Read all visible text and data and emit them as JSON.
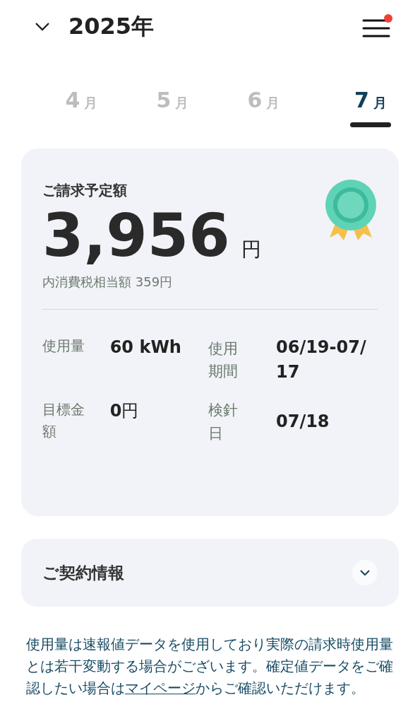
{
  "header": {
    "year": "2025年",
    "menu_badge": true
  },
  "month_tabs": [
    {
      "number": "4",
      "unit": "月",
      "selected": false
    },
    {
      "number": "5",
      "unit": "月",
      "selected": false
    },
    {
      "number": "6",
      "unit": "月",
      "selected": false
    },
    {
      "number": "7",
      "unit": "月",
      "selected": true
    }
  ],
  "bill": {
    "title": "ご請求予定額",
    "amount": "3,956",
    "currency": "円",
    "tax_note": "内消費税相当額 359円",
    "details": [
      {
        "label": "使用量",
        "value": "60 kWh"
      },
      {
        "label": "使用期間",
        "value": "06/19-07/17"
      },
      {
        "label": "目標金額",
        "value": "0",
        "unit": "円"
      },
      {
        "label": "検針日",
        "value": "07/18"
      }
    ]
  },
  "contract": {
    "title": "ご契約情報",
    "expanded": false
  },
  "note": {
    "before": "使用量は速報値データを使用しており実際の請求時使用量とは若干変動する場合がございます。確定値データをご確認したい場合は",
    "link": "マイページ",
    "after": "からご確認いただけます。"
  }
}
